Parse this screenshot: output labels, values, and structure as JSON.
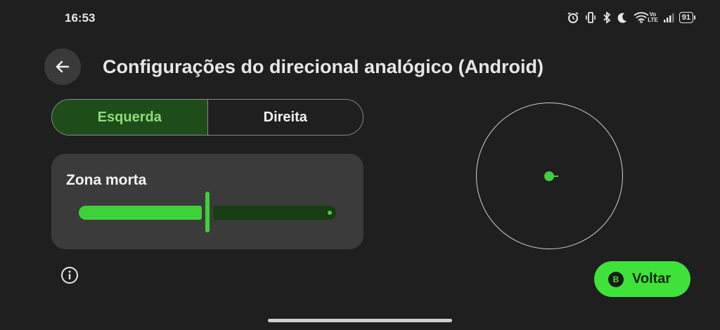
{
  "status_bar": {
    "time": "16:53",
    "icons": [
      "alarm-icon",
      "vibrate-icon",
      "bluetooth-icon",
      "moon-icon",
      "wifi-6-icon",
      "volte-icon",
      "signal-icon",
      "battery-icon"
    ],
    "wifi_label": "6",
    "volte_top": "Vo",
    "volte_bottom": "LTE",
    "battery_level": "91"
  },
  "header": {
    "back_icon": "arrow-left-icon",
    "title": "Configurações do direcional analógico (Android)"
  },
  "stick_selector": {
    "options": [
      {
        "label": "Esquerda",
        "selected": true
      },
      {
        "label": "Direita",
        "selected": false
      }
    ]
  },
  "dead_zone": {
    "title": "Zona morta",
    "value_fraction": 0.5
  },
  "info_icon": "info-icon",
  "preview": {
    "stick_offset": [
      0,
      0
    ]
  },
  "footer": {
    "button_badge": "B",
    "button_label": "Voltar"
  },
  "colors": {
    "accent": "#3fd13a",
    "accent_dark": "#173d12",
    "background": "#1f1f1f",
    "card": "#3b3b3b"
  }
}
